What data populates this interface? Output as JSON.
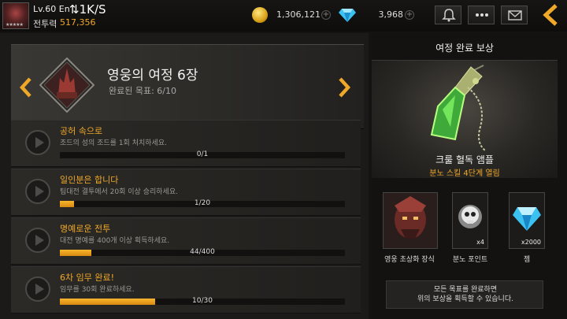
{
  "player": {
    "level": "Lv.60 En",
    "network_speed": "1K/S",
    "power_label": "전투력",
    "power_value": "517,356"
  },
  "currency": {
    "gold": "1,306,121",
    "gems": "3,968"
  },
  "chapter": {
    "title": "영웅의 여정 6장",
    "progress": "완료된 목표: 6/10"
  },
  "quests": [
    {
      "title": "공허 속으로",
      "description": "조드의 성의 조드를 1회 처치하세요.",
      "progress": "0/1",
      "fill": 0.0
    },
    {
      "title": "일인분은 합니다",
      "description": "팀대전 결투에서 20회 이상 승리하세요.",
      "progress": "1/20",
      "fill": 0.05
    },
    {
      "title": "명예로운 전투",
      "description": "대전 명예를 400개 이상 획득하세요.",
      "progress": "44/400",
      "fill": 0.11
    },
    {
      "title": "6차 임무 완료!",
      "description": "임무를 30회 완료하세요.",
      "progress": "10/30",
      "fill": 0.333
    }
  ],
  "reward_panel": {
    "title": "여정 완료 보상",
    "main_item_name": "크룰 혈독 앰플",
    "main_item_effect": "분노 스킬 4단계 열림",
    "sub_rewards": [
      {
        "name": "영웅 초상화 장식",
        "quantity": "",
        "icon": "portrait-icon"
      },
      {
        "name": "분노 포인트",
        "quantity": "x4",
        "icon": "skull-icon"
      },
      {
        "name": "젬",
        "quantity": "x2000",
        "icon": "gem-icon"
      }
    ],
    "notice_line1": "모든 목표를 완료하면",
    "notice_line2": "위의 보상을 획득할 수 있습니다."
  },
  "colors": {
    "accent": "#f0a828",
    "progress_fill": "#e89a18",
    "background": "#141311"
  }
}
